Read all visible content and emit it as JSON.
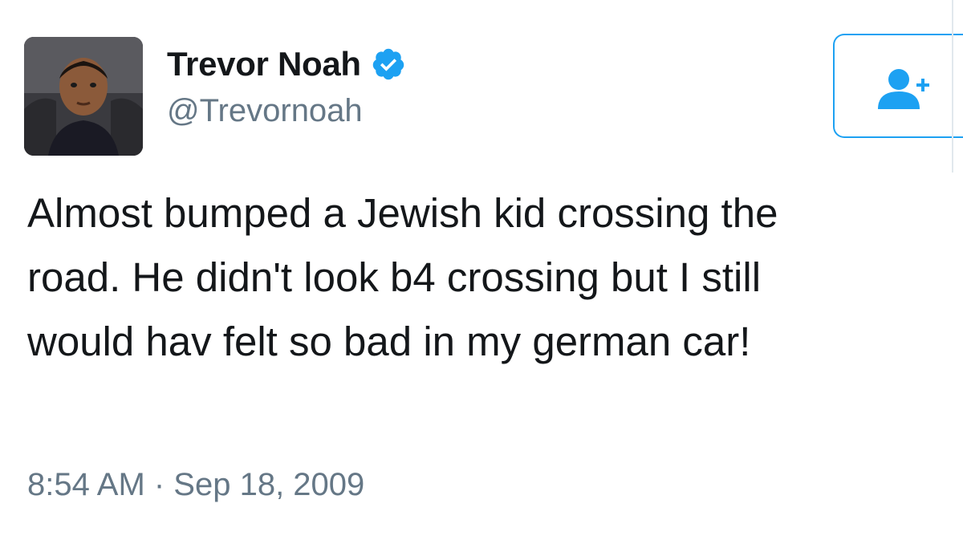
{
  "author": {
    "display_name": "Trevor Noah",
    "handle": "@Trevornoah",
    "verified": true,
    "avatar_icon": "profile-photo"
  },
  "follow_button": {
    "icon": "add-user-icon"
  },
  "tweet": {
    "lines": [
      "Almost bumped a Jewish kid crossing the",
      "road. He didn't look b4 crossing but I still",
      "would hav felt so bad in my german car!"
    ],
    "timestamp": "8:54 AM · Sep 18, 2009"
  },
  "colors": {
    "accent": "#1da1f2",
    "text": "#14171a",
    "secondary_text": "#657786"
  }
}
